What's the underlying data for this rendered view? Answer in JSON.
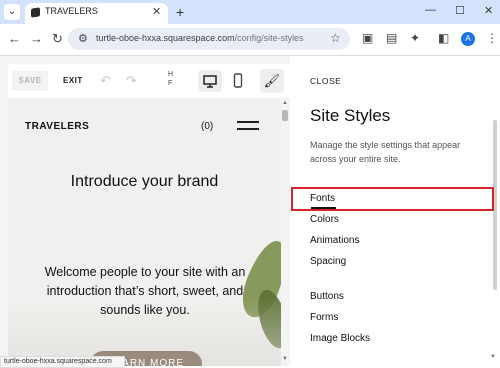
{
  "browser": {
    "tab_title": "TRAVELERS",
    "tab_close": "✕",
    "new_tab": "+",
    "tab_menu_glyph": "⌄",
    "window_controls": {
      "minimize": "—",
      "maximize": "☐",
      "close": "✕"
    },
    "url_domain": "turtle-oboe-hxxa.squarespace.com",
    "url_path": "/config/site-styles",
    "back_glyph": "←",
    "forward_glyph": "→",
    "reload_glyph": "↻",
    "star_glyph": "☆",
    "avatar_letter": "A",
    "status_url": "turtle-oboe-hxxa.squarespace.com"
  },
  "editor": {
    "save_label": "SAVE",
    "exit_label": "EXIT",
    "undo_glyph": "↶",
    "redo_glyph": "↷",
    "hf_text": "H\nF",
    "desktop_icon": "desktop-icon",
    "mobile_icon": "mobile-icon",
    "brush_icon": "brush-icon"
  },
  "site": {
    "brand": "TRAVELERS",
    "cart": "(0)",
    "heading": "Introduce your brand",
    "intro": "Welcome people to your site with an introduction that’s short, sweet, and sounds like you.",
    "button_label": "LEARN MORE"
  },
  "panel": {
    "close_label": "CLOSE",
    "title": "Site Styles",
    "description": "Manage the style settings that appear across your entire site.",
    "items": [
      "Fonts",
      "Colors",
      "Animations",
      "Spacing",
      "Buttons",
      "Forms",
      "Image Blocks"
    ]
  },
  "colors": {
    "highlight": "#d8232a",
    "tabstrip": "#d3e3fd",
    "avatar": "#1a73e8"
  }
}
